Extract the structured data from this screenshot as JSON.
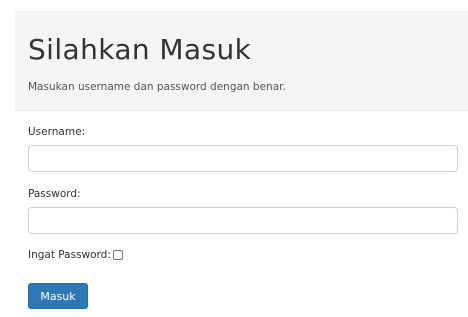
{
  "header": {
    "title": "Silahkan Masuk",
    "subtitle": "Masukan username dan password dengan benar."
  },
  "form": {
    "username_label": "Username:",
    "username_value": "",
    "password_label": "Password:",
    "password_value": "",
    "remember_label": "Ingat Password:",
    "remember_checked": false,
    "submit_label": "Masuk"
  },
  "colors": {
    "header_bg": "#f5f5f5",
    "button_bg": "#2f78b7",
    "button_text": "#ffffff"
  }
}
